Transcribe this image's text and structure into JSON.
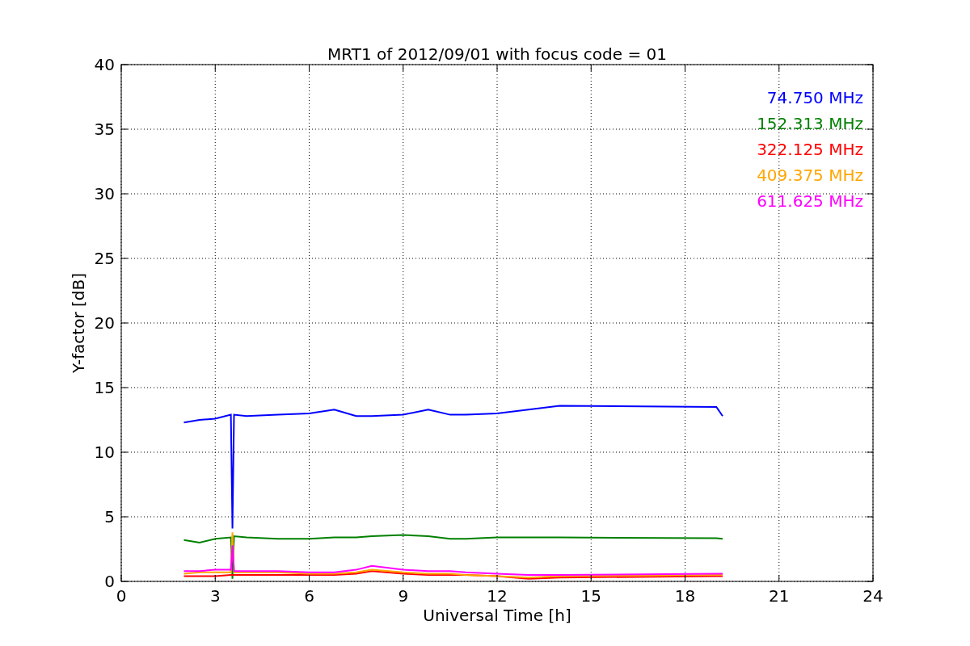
{
  "figure": {
    "chart_data": {
      "type": "line",
      "title": "MRT1 of 2012/09/01 with focus code = 01",
      "xlabel": "Universal Time [h]",
      "ylabel": "Y-factor [dB]",
      "x": [
        2,
        2.5,
        3,
        3.5,
        3.55,
        3.6,
        4,
        5,
        6,
        6.8,
        7.5,
        8,
        9,
        9.8,
        10.5,
        11,
        12,
        13,
        14,
        19,
        19.2
      ],
      "series": [
        {
          "name": "74.750 MHz",
          "color": "#0000ff",
          "values": [
            12.3,
            12.5,
            12.6,
            12.9,
            4.1,
            12.9,
            12.8,
            12.9,
            13.0,
            13.3,
            12.8,
            12.8,
            12.9,
            13.3,
            12.9,
            12.9,
            13.0,
            13.3,
            13.6,
            13.5,
            12.8
          ]
        },
        {
          "name": "152.313 MHz",
          "color": "#008000",
          "values": [
            3.2,
            3.0,
            3.3,
            3.4,
            0.2,
            3.5,
            3.4,
            3.3,
            3.3,
            3.4,
            3.4,
            3.5,
            3.6,
            3.5,
            3.3,
            3.3,
            3.4,
            3.4,
            3.4,
            3.35,
            3.3
          ]
        },
        {
          "name": "322.125 MHz",
          "color": "#ff0000",
          "values": [
            0.4,
            0.4,
            0.4,
            0.5,
            0.5,
            0.5,
            0.5,
            0.5,
            0.5,
            0.5,
            0.6,
            0.8,
            0.6,
            0.5,
            0.5,
            0.5,
            0.4,
            0.2,
            0.3,
            0.4,
            0.4
          ]
        },
        {
          "name": "409.375 MHz",
          "color": "#ffa500",
          "values": [
            0.6,
            0.7,
            0.7,
            0.7,
            3.8,
            0.7,
            0.7,
            0.7,
            0.6,
            0.6,
            0.7,
            0.9,
            0.7,
            0.6,
            0.6,
            0.5,
            0.4,
            0.3,
            0.4,
            0.5,
            0.5
          ]
        },
        {
          "name": "611.625 MHz",
          "color": "#ff00ff",
          "values": [
            0.8,
            0.8,
            0.9,
            0.9,
            2.8,
            0.8,
            0.8,
            0.8,
            0.7,
            0.7,
            0.9,
            1.2,
            0.9,
            0.8,
            0.8,
            0.7,
            0.6,
            0.5,
            0.5,
            0.6,
            0.6
          ]
        }
      ],
      "xlim": [
        0,
        24
      ],
      "ylim": [
        0,
        40
      ],
      "xticks": [
        0,
        3,
        6,
        9,
        12,
        15,
        18,
        21,
        24
      ],
      "yticks": [
        0,
        5,
        10,
        15,
        20,
        25,
        30,
        35,
        40
      ],
      "grid": true
    }
  }
}
